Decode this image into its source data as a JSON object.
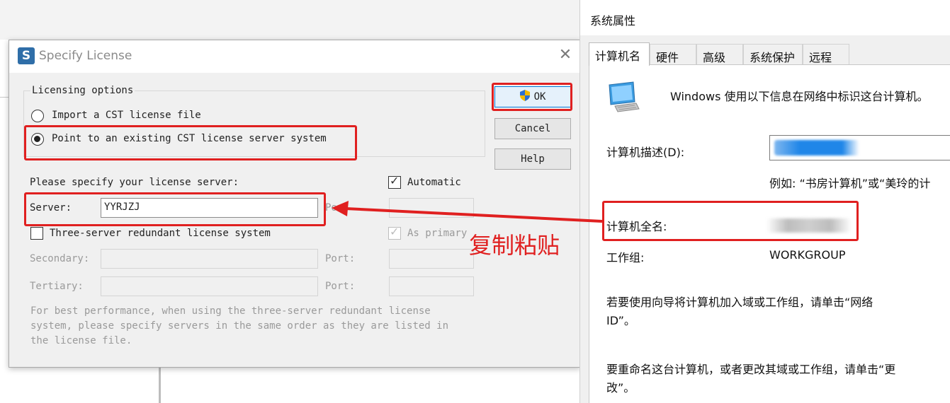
{
  "license_dialog": {
    "title": "Specify License",
    "logo_letter": "S",
    "close_glyph": "✕",
    "group_title": "Licensing options",
    "radio_import": "Import a CST license file",
    "radio_point": "Point to an existing CST license server system",
    "specify_label": "Please specify your license server:",
    "automatic_label": "Automatic",
    "server_label": "Server:",
    "server_value": "YYRJZJ",
    "port_label_hidden": "Port:",
    "three_server_label": "Three-server redundant license system",
    "as_primary_label": "As primary",
    "secondary_label": "Secondary:",
    "tertiary_label": "Tertiary:",
    "port_label": "Port:",
    "hint_lines": [
      "For best performance, when using the three-server redundant license",
      "system, please specify servers in the same order as they are listed in",
      "the license file."
    ],
    "ok_label": "OK",
    "cancel_label": "Cancel",
    "help_label": "Help",
    "selected_option": "point",
    "automatic_checked": true,
    "three_server_checked": false,
    "as_primary_checked": true
  },
  "annotation": {
    "text": "复制粘贴",
    "color": "#e02020"
  },
  "system_properties": {
    "title": "系统属性",
    "tabs": [
      "计算机名",
      "硬件",
      "高级",
      "系统保护",
      "远程"
    ],
    "active_tab": "计算机名",
    "intro": "Windows 使用以下信息在网络中标识这台计算机。",
    "desc_label": "计算机描述(D):",
    "desc_example": "例如: “书房计算机”或“美玲的计",
    "full_name_label": "计算机全名:",
    "workgroup_label": "工作组:",
    "workgroup_value": "WORKGROUP",
    "network_id_text_1": "若要使用向导将计算机加入域或工作组，请单击“网络",
    "network_id_text_2": "ID”。",
    "rename_text_1": "要重命名这台计算机，或者更改其域或工作组，请单击“更",
    "rename_text_2": "改”。"
  },
  "icons": {
    "computer": "computer-icon",
    "shield": "uac-shield-icon",
    "logo": "cst-logo-icon"
  }
}
